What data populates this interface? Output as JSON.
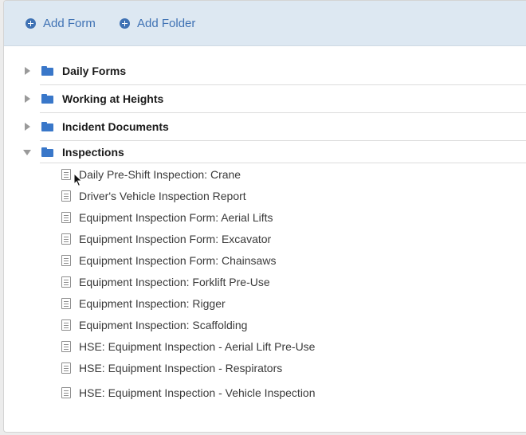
{
  "toolbar": {
    "add_form_label": "Add Form",
    "add_folder_label": "Add Folder"
  },
  "folders": [
    {
      "label": "Daily Forms",
      "expanded": false
    },
    {
      "label": "Working at Heights",
      "expanded": false
    },
    {
      "label": "Incident Documents",
      "expanded": false
    },
    {
      "label": "Inspections",
      "expanded": true
    }
  ],
  "inspection_forms": [
    "Daily Pre-Shift Inspection: Crane",
    "Driver's Vehicle Inspection Report",
    "Equipment Inspection Form: Aerial Lifts",
    "Equipment Inspection Form: Excavator",
    "Equipment Inspection Form: Chainsaws",
    "Equipment Inspection: Forklift Pre-Use",
    "Equipment Inspection: Rigger",
    "Equipment Inspection: Scaffolding",
    "HSE: Equipment Inspection - Aerial Lift Pre-Use",
    "HSE: Equipment Inspection - Respirators",
    "HSE: Equipment Inspection - Vehicle Inspection"
  ],
  "colors": {
    "accent": "#3f72b4",
    "folder": "#3977c9",
    "toolbar_bg": "#dde8f2"
  }
}
